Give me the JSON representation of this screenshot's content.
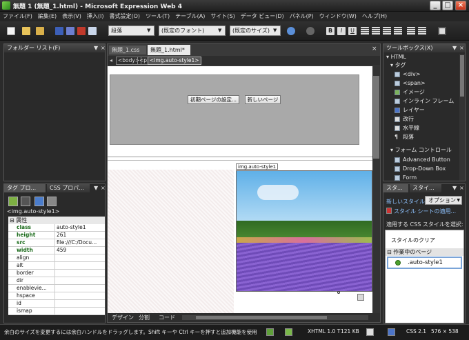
{
  "window": {
    "title": "無題 1 (無題_1.html) - Microsoft Expression Web 4",
    "min_label": "_",
    "max_label": "□",
    "close_label": "×"
  },
  "menu": [
    "ファイル(F)",
    "編集(E)",
    "表示(V)",
    "挿入(I)",
    "書式設定(O)",
    "ツール(T)",
    "テーブル(A)",
    "サイト(S)",
    "データ ビュー(D)",
    "パネル(P)",
    "ウィンドウ(W)",
    "ヘルプ(H)"
  ],
  "toolbar": {
    "style_select": "段落",
    "font_select": "(既定のフォント)",
    "size_select": "(既定のサイズ)"
  },
  "folder_panel": {
    "title": "フォルダー リスト(F)"
  },
  "tag_panel": {
    "tab1": "タグ プロ...",
    "tab2": "CSS プロパ...",
    "selected_tag": "<img.auto-style1>",
    "group_label": "属性",
    "attributes": [
      {
        "name": "class",
        "value": "auto-style1",
        "set": true
      },
      {
        "name": "height",
        "value": "261",
        "set": true
      },
      {
        "name": "src",
        "value": "file:///C:/Docu...",
        "set": true
      },
      {
        "name": "width",
        "value": "459",
        "set": true
      },
      {
        "name": "align",
        "value": "",
        "set": false
      },
      {
        "name": "alt",
        "value": "",
        "set": false
      },
      {
        "name": "border",
        "value": "",
        "set": false
      },
      {
        "name": "dir",
        "value": "",
        "set": false
      },
      {
        "name": "enablevie...",
        "value": "",
        "set": false
      },
      {
        "name": "hspace",
        "value": "",
        "set": false
      },
      {
        "name": "id",
        "value": "",
        "set": false
      },
      {
        "name": "ismap",
        "value": "",
        "set": false
      }
    ]
  },
  "editor": {
    "tabs": [
      "無題_1.css",
      "無題_1.html*"
    ],
    "breadcrumb": [
      "<body>",
      "<p>",
      "<img.auto-style1>"
    ],
    "button_initial": "初期ページの設定...",
    "button_new": "新しいページ",
    "image_label": "img.auto-style1",
    "view_tabs": [
      "デザイン",
      "分割",
      "コード"
    ]
  },
  "toolbox": {
    "title": "ツールボックス(X)",
    "html_group": "HTML",
    "tags_group": "タグ",
    "tags": [
      "<div>",
      "<span>",
      "イメージ",
      "インライン フレーム",
      "レイヤー",
      "改行",
      "水平線",
      "段落"
    ],
    "form_group": "フォーム コントロール",
    "form_items": [
      "Advanced Button",
      "Drop-Down Box",
      "Form"
    ]
  },
  "styles_panel": {
    "tab1": "スタ...",
    "tab2": "スタイ...",
    "new_style": "新しいスタイル...",
    "options": "オプション",
    "attach_sheet": "スタイル シートの適用...",
    "select_label": "適用する CSS スタイルを選択:",
    "clear_style": "スタイルのクリア",
    "group": "作業中のページ",
    "style_item": ".auto-style1"
  },
  "status": {
    "message": "余白のサイズを変更するには余白ハンドルをドラッグします。Shift キーや Ctrl キーを押すと追加機能を使用できます。",
    "doctype": "XHTML 1.0 T",
    "filesize": "121 KB",
    "css_level": "CSS 2.1",
    "page_size": "576 × 538"
  }
}
